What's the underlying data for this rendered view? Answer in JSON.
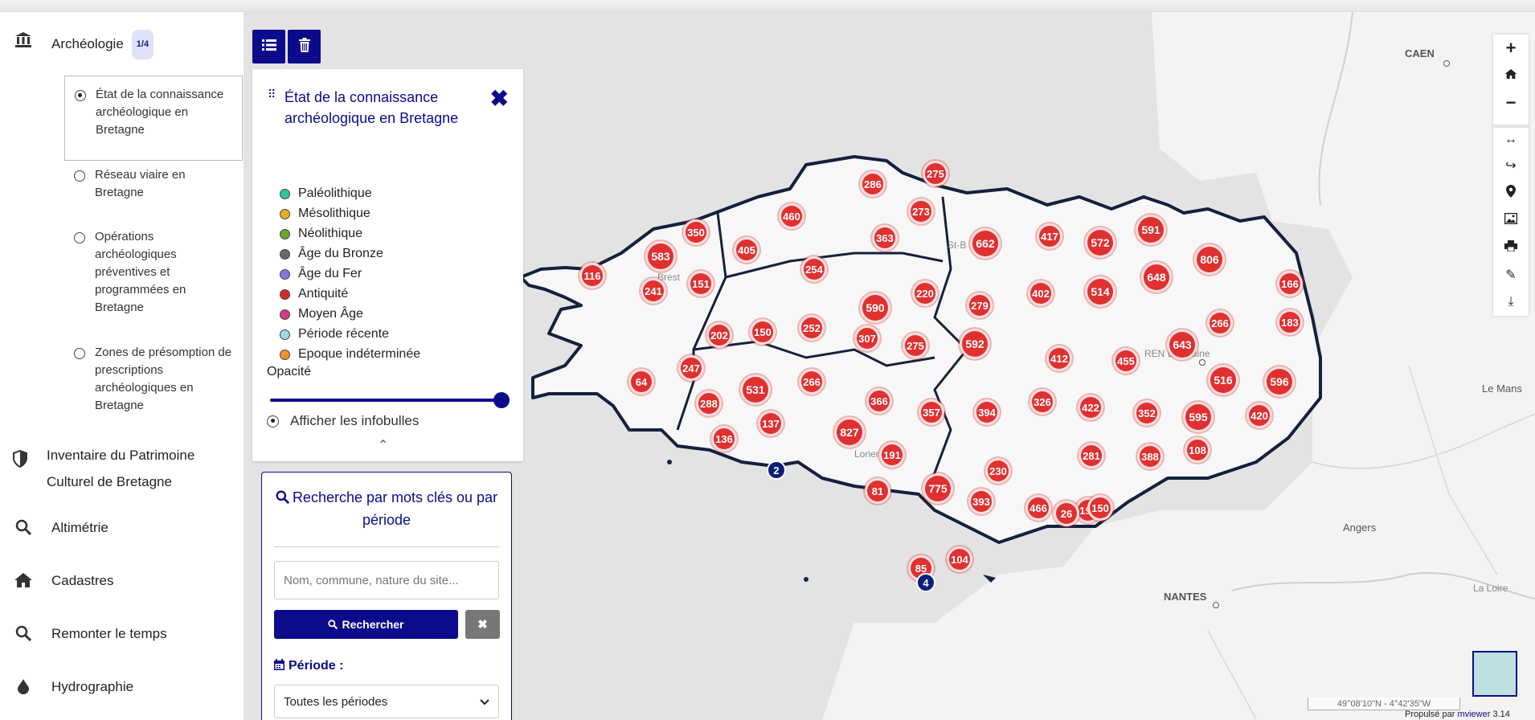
{
  "sidebar": {
    "categories": [
      {
        "label": "Archéologie",
        "badge": "1/4",
        "icon": "museum-icon"
      },
      {
        "label": "Inventaire du Patrimoine",
        "label2": "Culturel de Bretagne",
        "icon": "shield-icon"
      },
      {
        "label": "Altimétrie",
        "icon": "search-icon"
      },
      {
        "label": "Cadastres",
        "icon": "home-icon"
      },
      {
        "label": "Remonter le temps",
        "icon": "search-icon"
      },
      {
        "label": "Hydrographie",
        "icon": "drop-icon"
      }
    ],
    "layers": [
      {
        "label": "État de la connaissance archéologique en Bretagne",
        "selected": true
      },
      {
        "label": "Réseau viaire en Bretagne",
        "selected": false
      },
      {
        "label": "Opérations archéologiques préventives et programmées en Bretagne",
        "selected": false
      },
      {
        "label": "Zones de présomption de prescriptions archéologiques en Bretagne",
        "selected": false
      }
    ]
  },
  "toolbar": {
    "list_icon": "list-icon",
    "delete_icon": "trash-icon"
  },
  "legend": {
    "title": "État de la connaissance archéologique en Bretagne",
    "items": [
      {
        "label": "Paléolithique",
        "color": "#2ec4a0"
      },
      {
        "label": "Mésolithique",
        "color": "#e6b020"
      },
      {
        "label": "Néolithique",
        "color": "#6aa62a"
      },
      {
        "label": "Âge du Bronze",
        "color": "#6b6b6b"
      },
      {
        "label": "Âge du Fer",
        "color": "#7b7bd8"
      },
      {
        "label": "Antiquité",
        "color": "#d42a2a"
      },
      {
        "label": "Moyen Âge",
        "color": "#d43a8a"
      },
      {
        "label": "Période récente",
        "color": "#9ad8e8"
      },
      {
        "label": "Epoque indéterminée",
        "color": "#f0902a"
      }
    ],
    "opacity_label": "Opacité",
    "opacity_value": 1.0,
    "tooltips_label": "Afficher les infobulles"
  },
  "search": {
    "title": "Recherche par mots clés ou par période",
    "placeholder": "Nom, commune, nature du site...",
    "button_label": "Rechercher",
    "period_label": "Période :",
    "period_selected": "Toutes les périodes"
  },
  "map": {
    "cluster_color": "#e03030",
    "blue_cluster_color": "#0b1f7a",
    "clusters": [
      "116",
      "583",
      "350",
      "241",
      "151",
      "405",
      "460",
      "254",
      "286",
      "275",
      "273",
      "363",
      "662",
      "417",
      "572",
      "591",
      "806",
      "648",
      "166",
      "590",
      "220",
      "279",
      "402",
      "514",
      "202",
      "150",
      "252",
      "307",
      "275",
      "592",
      "412",
      "455",
      "643",
      "266",
      "183",
      "64",
      "247",
      "531",
      "266",
      "288",
      "366",
      "357",
      "394",
      "326",
      "422",
      "352",
      "595",
      "420",
      "516",
      "596",
      "136",
      "137",
      "827",
      "191",
      "230",
      "281",
      "388",
      "108",
      "81",
      "775",
      "393",
      "466",
      "198",
      "26",
      "150",
      "85",
      "104"
    ],
    "blue_clusters": [
      "2",
      "4"
    ],
    "places": [
      {
        "name": "CAEN"
      },
      {
        "name": "Brest"
      },
      {
        "name": "St-B"
      },
      {
        "name": "REN"
      },
      {
        "name": "La Vilaine"
      },
      {
        "name": "Lorient"
      },
      {
        "name": "Le Mans"
      },
      {
        "name": "Angers"
      },
      {
        "name": "NANTES"
      },
      {
        "name": "La Loire"
      }
    ],
    "coords": "49°08'10\"N - 4°42'35\"W",
    "credit_prefix": "Propulsé par",
    "credit_link": "mviewer",
    "credit_version": "3.14"
  }
}
